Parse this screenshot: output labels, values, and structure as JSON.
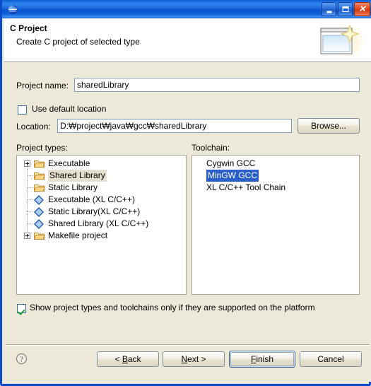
{
  "window": {
    "title": "",
    "icon": "eclipse-globe-icon",
    "buttons": {
      "minimize": "minimize-button",
      "maximize": "maximize-button",
      "close": "close-button"
    }
  },
  "banner": {
    "title": "C Project",
    "subtitle": "Create C project of selected type",
    "image": "new-project-wizard-icon"
  },
  "form": {
    "project_name_label": "Project name:",
    "project_name_value": "sharedLibrary",
    "use_default_location_label": "Use default location",
    "use_default_location_checked": false,
    "location_label": "Location:",
    "location_value": "D:₩project₩java₩gcc₩sharedLibrary",
    "browse_label": "Browse..."
  },
  "project_types": {
    "label": "Project types:",
    "items": [
      {
        "label": "Executable",
        "icon": "folder-icon",
        "indent": 0,
        "expander": true,
        "selected": false
      },
      {
        "label": "Shared Library",
        "icon": "folder-icon",
        "indent": 1,
        "expander": false,
        "selected": true
      },
      {
        "label": "Static Library",
        "icon": "folder-icon",
        "indent": 1,
        "expander": false,
        "selected": false
      },
      {
        "label": "Executable (XL C/C++)",
        "icon": "diamond-icon",
        "indent": 1,
        "expander": false,
        "selected": false
      },
      {
        "label": "Static Library(XL C/C++)",
        "icon": "diamond-icon",
        "indent": 1,
        "expander": false,
        "selected": false
      },
      {
        "label": "Shared Library (XL C/C++)",
        "icon": "diamond-icon",
        "indent": 1,
        "expander": false,
        "selected": false
      },
      {
        "label": "Makefile project",
        "icon": "folder-icon",
        "indent": 0,
        "expander": true,
        "selected": false
      }
    ]
  },
  "toolchain": {
    "label": "Toolchain:",
    "items": [
      {
        "label": "Cygwin GCC",
        "selected": false
      },
      {
        "label": "MinGW GCC",
        "selected": true
      },
      {
        "label": "XL C/C++ Tool Chain",
        "selected": false
      }
    ]
  },
  "options": {
    "show_supported_label": "Show project types and toolchains only if they are supported on the platform",
    "show_supported_checked": true
  },
  "footer": {
    "help": "help-icon",
    "back_label": "< Back",
    "back_mnemonic": "B",
    "next_label": "Next >",
    "next_mnemonic": "N",
    "finish_label": "Finish",
    "finish_mnemonic": "F",
    "cancel_label": "Cancel"
  },
  "colors": {
    "dialog_bg": "#ece9d8",
    "frame_blue": "#0a49c8",
    "selection_blue": "#2b5fc9",
    "selection_grey": "#e4e0d0",
    "field_border": "#7f9db9",
    "check_green": "#1f9c2f"
  }
}
